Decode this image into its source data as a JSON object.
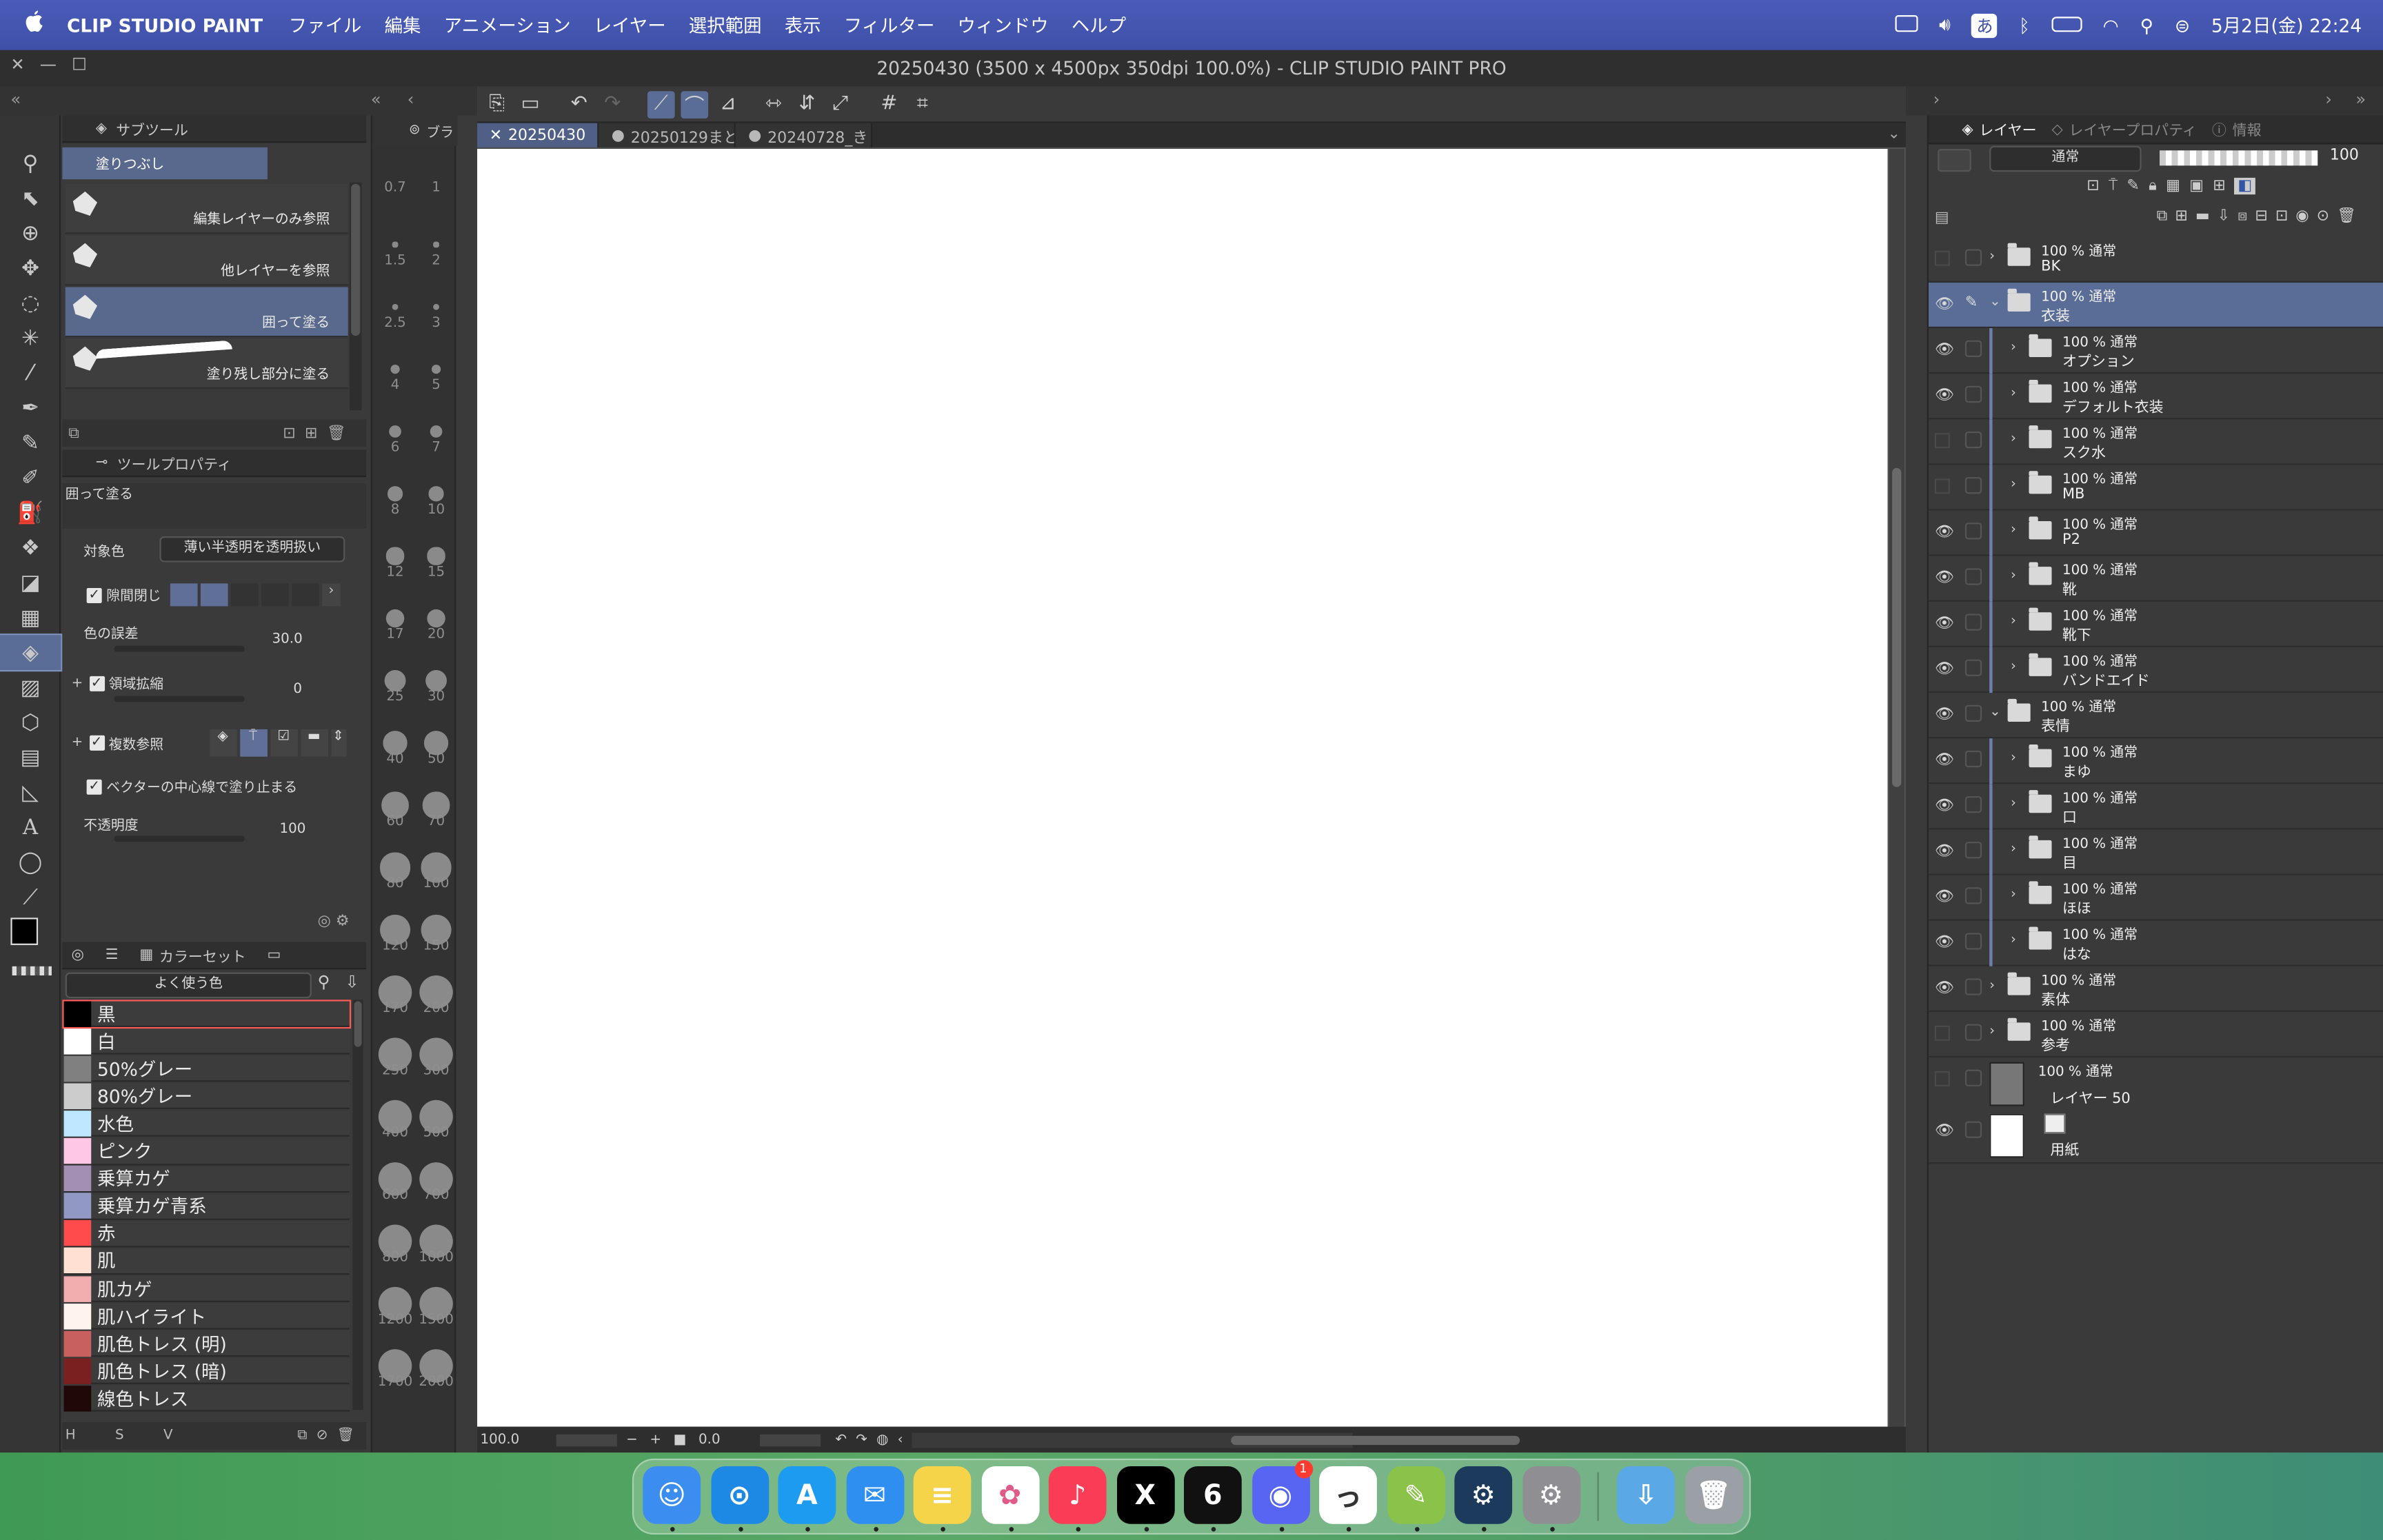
{
  "menubar": {
    "apple": "",
    "app_name": "CLIP STUDIO PAINT",
    "menus": [
      "ファイル",
      "編集",
      "アニメーション",
      "レイヤー",
      "選択範囲",
      "表示",
      "フィルター",
      "ウィンドウ",
      "ヘルプ"
    ],
    "input_mode": "あ",
    "date_time": "5月2日(金)  22:24"
  },
  "window": {
    "title": "20250430 (3500 x 4500px 350dpi 100.0%)  - CLIP STUDIO PAINT PRO"
  },
  "subtool_panel": {
    "tab_label": "サブツール",
    "group_label": "塗りつぶし",
    "items": [
      {
        "label": "編集レイヤーのみ参照"
      },
      {
        "label": "他レイヤーを参照"
      },
      {
        "label": "囲って塗る"
      },
      {
        "label": "塗り残し部分に塗る"
      }
    ]
  },
  "tool_property": {
    "tab_label": "ツールプロパティ",
    "tool_name": "囲って塗る",
    "target_color_label": "対象色",
    "target_color_value": "薄い半透明を透明扱い",
    "close_gap_label": "隙間閉じ",
    "tolerance_label": "色の誤差",
    "tolerance_value": "30.0",
    "area_scaling_label": "領域拡縮",
    "area_scaling_value": "0",
    "multi_ref_label": "複数参照",
    "vector_center_label": "ベクターの中心線で塗り止まる",
    "opacity_label": "不透明度",
    "opacity_value": "100"
  },
  "brush_sizes": [
    "0.7",
    "1",
    "1.5",
    "2",
    "2.5",
    "3",
    "4",
    "5",
    "6",
    "7",
    "8",
    "10",
    "12",
    "15",
    "17",
    "20",
    "25",
    "30",
    "40",
    "50",
    "60",
    "70",
    "80",
    "100",
    "120",
    "150",
    "170",
    "200",
    "250",
    "300",
    "400",
    "500",
    "600",
    "700",
    "800",
    "1000",
    "1200",
    "1500",
    "1700",
    "2000"
  ],
  "side_tab_label": "ブラ",
  "colorset": {
    "tab_label": "カラーセット",
    "set_name": "よく使う色",
    "footer_letters": [
      "H",
      "S",
      "V"
    ],
    "swatches": [
      {
        "name": "黒",
        "color": "#000000"
      },
      {
        "name": "白",
        "color": "#ffffff"
      },
      {
        "name": "50%グレー",
        "color": "#808080"
      },
      {
        "name": "80%グレー",
        "color": "#cccccc"
      },
      {
        "name": "水色",
        "color": "#bde8ff"
      },
      {
        "name": "ピンク",
        "color": "#ffc7e6"
      },
      {
        "name": "乗算カゲ",
        "color": "#a48fb4"
      },
      {
        "name": "乗算カゲ青系",
        "color": "#9298c4"
      },
      {
        "name": "赤",
        "color": "#ff4b4b"
      },
      {
        "name": "肌",
        "color": "#ffe0d2"
      },
      {
        "name": "肌カゲ",
        "color": "#f2aeae"
      },
      {
        "name": "肌ハイライト",
        "color": "#fff3ef"
      },
      {
        "name": "肌色トレス (明)",
        "color": "#c86060"
      },
      {
        "name": "肌色トレス (暗)",
        "color": "#7a2020"
      },
      {
        "name": "線色トレス",
        "color": "#200808"
      }
    ]
  },
  "canvas": {
    "tabs": [
      {
        "label": "20250430",
        "active": true
      },
      {
        "label": "20250129まと",
        "active": false
      },
      {
        "label": "20240728_き",
        "active": false
      }
    ],
    "zoom": "100.0",
    "rotation": "0.0"
  },
  "layers_panel": {
    "tabs": [
      "レイヤー",
      "レイヤープロパティ",
      "情報"
    ],
    "blend_mode": "通常",
    "opacity": "100",
    "layers": [
      {
        "mode": "100 %  通常",
        "name": "BK",
        "type": "folder",
        "depth": 0,
        "visible": false,
        "selected": false
      },
      {
        "mode": "100 %  通常",
        "name": "衣装",
        "type": "folder",
        "depth": 0,
        "visible": true,
        "selected": true,
        "open": true
      },
      {
        "mode": "100 %  通常",
        "name": "オプション",
        "type": "folder",
        "depth": 1,
        "visible": true,
        "selected": false
      },
      {
        "mode": "100 %  通常",
        "name": "デフォルト衣装",
        "type": "folder",
        "depth": 1,
        "visible": true,
        "selected": false
      },
      {
        "mode": "100 %  通常",
        "name": "スク水",
        "type": "folder",
        "depth": 1,
        "visible": false,
        "selected": false
      },
      {
        "mode": "100 %  通常",
        "name": "MB",
        "type": "folder",
        "depth": 1,
        "visible": false,
        "selected": false
      },
      {
        "mode": "100 %  通常",
        "name": "P2",
        "type": "folder",
        "depth": 1,
        "visible": true,
        "selected": false
      },
      {
        "mode": "100 %  通常",
        "name": "靴",
        "type": "folder",
        "depth": 1,
        "visible": true,
        "selected": false
      },
      {
        "mode": "100 %  通常",
        "name": "靴下",
        "type": "folder",
        "depth": 1,
        "visible": true,
        "selected": false
      },
      {
        "mode": "100 %  通常",
        "name": "バンドエイド",
        "type": "folder",
        "depth": 1,
        "visible": true,
        "selected": false
      },
      {
        "mode": "100 %  通常",
        "name": "表情",
        "type": "folder",
        "depth": 0,
        "visible": true,
        "selected": false,
        "open": true
      },
      {
        "mode": "100 %  通常",
        "name": "まゆ",
        "type": "folder",
        "depth": 1,
        "visible": true,
        "selected": false
      },
      {
        "mode": "100 %  通常",
        "name": "口",
        "type": "folder",
        "depth": 1,
        "visible": true,
        "selected": false
      },
      {
        "mode": "100 %  通常",
        "name": "目",
        "type": "folder",
        "depth": 1,
        "visible": true,
        "selected": false
      },
      {
        "mode": "100 %  通常",
        "name": "ほほ",
        "type": "folder",
        "depth": 1,
        "visible": true,
        "selected": false
      },
      {
        "mode": "100 %  通常",
        "name": "はな",
        "type": "folder",
        "depth": 1,
        "visible": true,
        "selected": false
      },
      {
        "mode": "100 %  通常",
        "name": "素体",
        "type": "folder",
        "depth": 0,
        "visible": true,
        "selected": false
      },
      {
        "mode": "100 %  通常",
        "name": "参考",
        "type": "folder",
        "depth": 0,
        "visible": false,
        "selected": false
      },
      {
        "mode": "100 %  通常",
        "name": "レイヤー 50",
        "type": "raster",
        "depth": 0,
        "visible": false,
        "selected": false
      },
      {
        "mode": "",
        "name": "用紙",
        "type": "paper",
        "depth": 0,
        "visible": true,
        "selected": false
      }
    ]
  },
  "dock": {
    "apps": [
      {
        "name": "Finder",
        "icon": "finder-icon",
        "color": "#3b8ef0",
        "glyph": "☺"
      },
      {
        "name": "Safari",
        "icon": "safari-icon",
        "color": "#1e88e5",
        "glyph": "⊙"
      },
      {
        "name": "App Store",
        "icon": "appstore-icon",
        "color": "#1c9bf0",
        "glyph": "A"
      },
      {
        "name": "Mail",
        "icon": "mail-icon",
        "color": "#2f8ff0",
        "glyph": "✉"
      },
      {
        "name": "Notes",
        "icon": "notes-icon",
        "color": "#f5d44a",
        "glyph": "≡"
      },
      {
        "name": "Photos",
        "icon": "photos-icon",
        "color": "#ffffff",
        "glyph": "✿"
      },
      {
        "name": "Music",
        "icon": "music-icon",
        "color": "#fa3c56",
        "glyph": "♪"
      },
      {
        "name": "X",
        "icon": "x-icon",
        "color": "#000000",
        "glyph": "X"
      },
      {
        "name": "Threads-like",
        "icon": "six-icon",
        "color": "#111111",
        "glyph": "6"
      },
      {
        "name": "Discord",
        "icon": "discord-icon",
        "color": "#5865f2",
        "glyph": "◉"
      },
      {
        "name": "Clip Studio",
        "icon": "clipstudio-icon",
        "color": "#ffffff",
        "glyph": "っ"
      },
      {
        "name": "Clip Studio Paint",
        "icon": "clipstudiopaint-icon",
        "color": "#8bc34a",
        "glyph": "✎"
      },
      {
        "name": "Steam",
        "icon": "steam-icon",
        "color": "#1b3a5c",
        "glyph": "⚙"
      },
      {
        "name": "System Settings",
        "icon": "settings-icon",
        "color": "#8e8e93",
        "glyph": "⚙"
      },
      {
        "name": "Downloads",
        "icon": "downloads-icon",
        "color": "#5aa9e6",
        "glyph": "⇩"
      },
      {
        "name": "Trash",
        "icon": "trash-icon",
        "color": "#9aa0a6",
        "glyph": "🗑"
      }
    ],
    "discord_badge": "1"
  }
}
